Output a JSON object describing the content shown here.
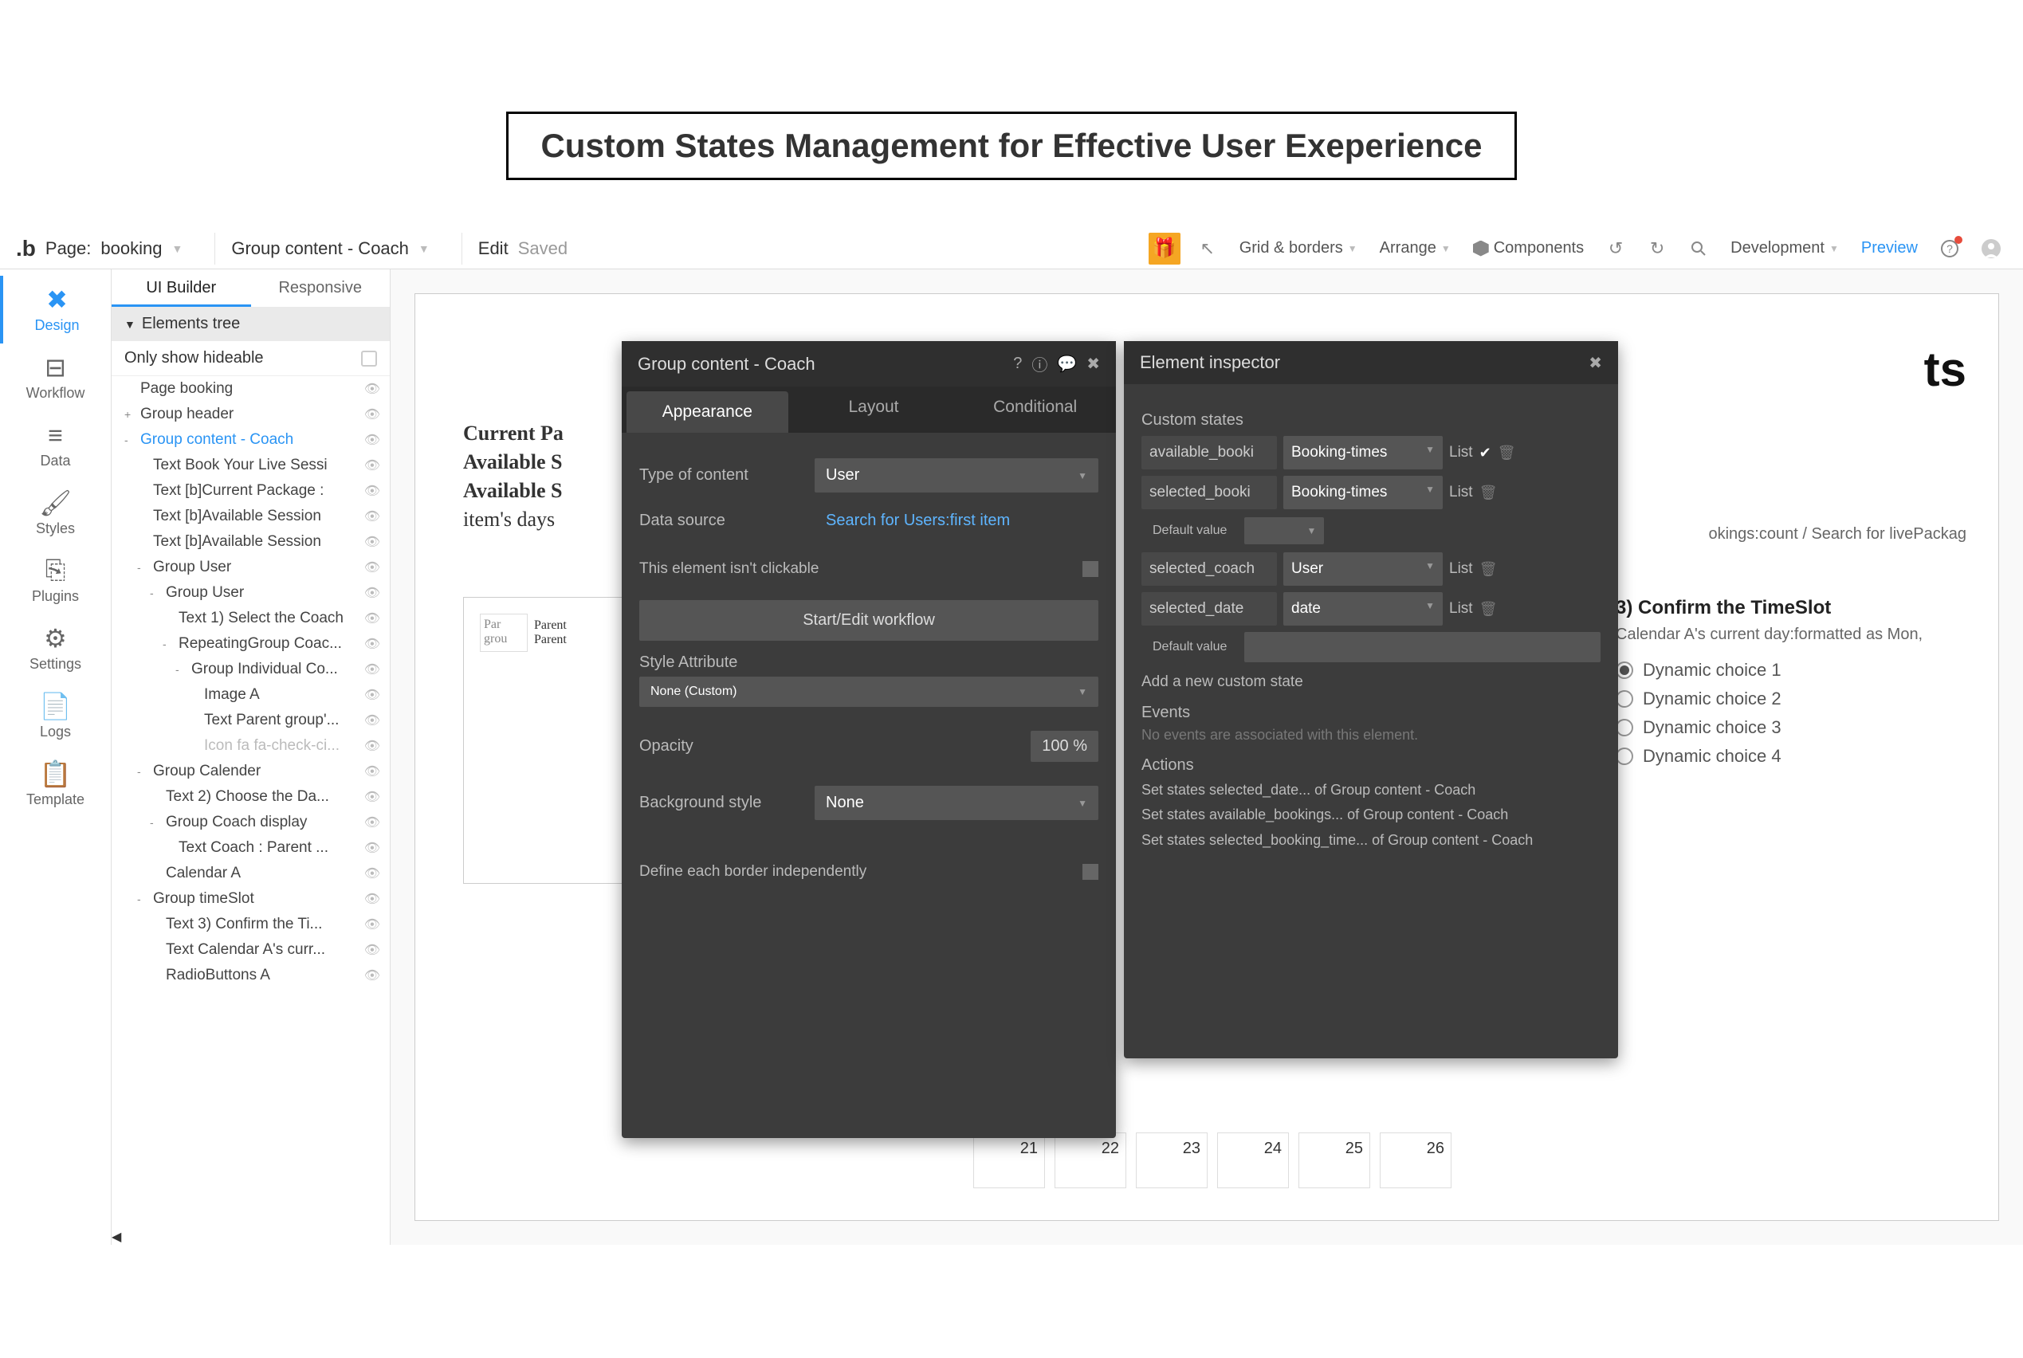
{
  "banner": "Custom States Management for Effective User Exeperience",
  "toolbar": {
    "page_label": "Page:",
    "page_name": "booking",
    "element_selector": "Group content - Coach",
    "edit": "Edit",
    "saved": "Saved",
    "grid_borders": "Grid & borders",
    "arrange": "Arrange",
    "components": "Components",
    "development": "Development",
    "preview": "Preview"
  },
  "left_rail": {
    "design": "Design",
    "workflow": "Workflow",
    "data": "Data",
    "styles": "Styles",
    "plugins": "Plugins",
    "settings": "Settings",
    "logs": "Logs",
    "template": "Template"
  },
  "left_panel": {
    "tab_ui": "UI Builder",
    "tab_resp": "Responsive",
    "tree_header": "Elements tree",
    "hideable": "Only show hideable",
    "tree": [
      {
        "l": 0,
        "t": "Page booking"
      },
      {
        "l": 0,
        "t": "Group header",
        "tog": "+"
      },
      {
        "l": 0,
        "t": "Group content - Coach",
        "sel": true,
        "tog": "-"
      },
      {
        "l": 1,
        "t": "Text Book Your Live Sessi"
      },
      {
        "l": 1,
        "t": "Text [b]Current Package :"
      },
      {
        "l": 1,
        "t": "Text [b]Available Session"
      },
      {
        "l": 1,
        "t": "Text [b]Available Session"
      },
      {
        "l": 1,
        "t": "Group User",
        "tog": "-"
      },
      {
        "l": 2,
        "t": "Group User",
        "tog": "-"
      },
      {
        "l": 3,
        "t": "Text 1) Select the Coach"
      },
      {
        "l": 3,
        "t": "RepeatingGroup Coac...",
        "tog": "-"
      },
      {
        "l": 4,
        "t": "Group Individual Co...",
        "tog": "-"
      },
      {
        "l": 5,
        "t": "Image A"
      },
      {
        "l": 5,
        "t": "Text Parent group'..."
      },
      {
        "l": 5,
        "t": "Icon fa fa-check-ci...",
        "dim": true
      },
      {
        "l": 1,
        "t": "Group Calender",
        "tog": "-"
      },
      {
        "l": 2,
        "t": "Text 2) Choose the Da..."
      },
      {
        "l": 2,
        "t": "Group Coach display",
        "tog": "-"
      },
      {
        "l": 3,
        "t": "Text Coach : Parent ..."
      },
      {
        "l": 2,
        "t": "Calendar A"
      },
      {
        "l": 1,
        "t": "Group timeSlot",
        "tog": "-"
      },
      {
        "l": 2,
        "t": "Text 3) Confirm the Ti..."
      },
      {
        "l": 2,
        "t": "Text Calendar A's curr..."
      },
      {
        "l": 2,
        "t": "RadioButtons A"
      }
    ]
  },
  "canvas": {
    "heading_suffix": "ts",
    "line1": "Current Pa",
    "line2": "Available S",
    "line3a": "Available S",
    "line3b": "item's days",
    "box_l1": "Par",
    "box_l2": "grou",
    "box_t1": "Parent",
    "box_t2": "Parent",
    "meta": "okings:count / Search for livePackag",
    "step3_h": "3) Confirm the TimeSlot",
    "step3_sub": "Calendar A's current day:formatted as Mon,",
    "opts": [
      "Dynamic choice 1",
      "Dynamic choice 2",
      "Dynamic choice 3",
      "Dynamic choice 4"
    ],
    "cal": [
      "21",
      "22",
      "23",
      "24",
      "25",
      "26"
    ]
  },
  "prop": {
    "title": "Group content - Coach",
    "tab_app": "Appearance",
    "tab_layout": "Layout",
    "tab_cond": "Conditional",
    "type_label": "Type of content",
    "type_value": "User",
    "ds_label": "Data source",
    "ds_value": "Search for Users:first item",
    "clickable": "This element isn't clickable",
    "workflow_btn": "Start/Edit workflow",
    "style_attr": "Style Attribute",
    "style_value": "None (Custom)",
    "opacity_label": "Opacity",
    "opacity_value": "100 %",
    "bg_label": "Background style",
    "bg_value": "None",
    "border_label": "Define each border independently"
  },
  "insp": {
    "title": "Element inspector",
    "cs_header": "Custom states",
    "states": [
      {
        "name": "available_booki",
        "type": "Booking-times",
        "list": true,
        "checked": true
      },
      {
        "name": "selected_booki",
        "type": "Booking-times",
        "list": true,
        "checked": false
      },
      {
        "name": "selected_coach",
        "type": "User",
        "list": true,
        "checked": false
      },
      {
        "name": "selected_date",
        "type": "date",
        "list": true,
        "checked": false
      }
    ],
    "default_label": "Default value",
    "add_state": "Add a new custom state",
    "events": "Events",
    "events_empty": "No events are associated with this element.",
    "actions": "Actions",
    "action_list": [
      "Set states selected_date... of Group content - Coach",
      "Set states available_bookings... of Group content - Coach",
      "Set states selected_booking_time... of Group content - Coach"
    ],
    "list_label": "List"
  }
}
